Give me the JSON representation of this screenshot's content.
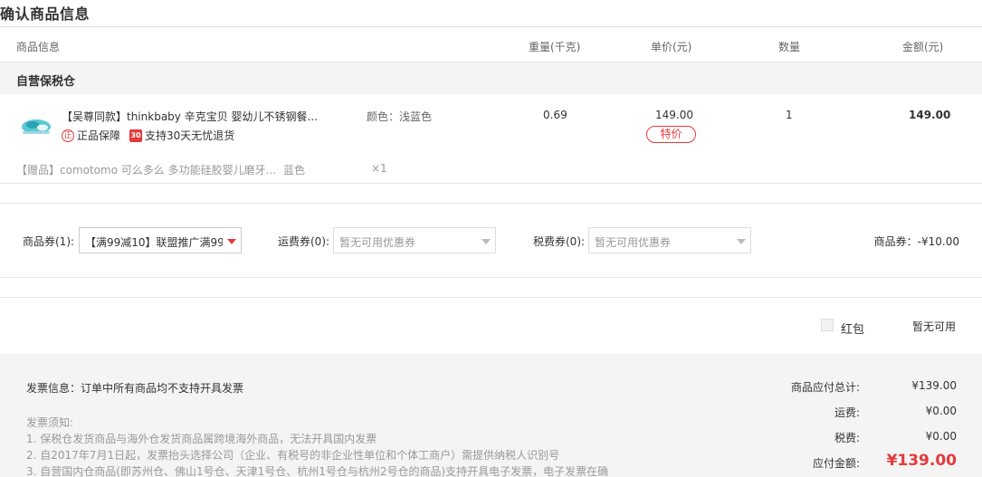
{
  "page_title": "确认商品信息",
  "columns": {
    "goods": "商品信息",
    "weight": "重量(千克)",
    "unit_price": "单价(元)",
    "quantity": "数量",
    "amount": "金额(元)"
  },
  "warehouse": "自营保税仓",
  "product": {
    "name": "【吴尊同款】thinkbaby 辛克宝贝 婴幼儿不锈钢餐...",
    "badge_authentic": "正品保障",
    "badge_30_icon": "30",
    "badge_return": "支持30天无忧退货",
    "color": "颜色：浅蓝色",
    "weight": "0.69",
    "price": "149.00",
    "price_tag": "特价",
    "qty": "1",
    "amount": "149.00"
  },
  "gift": {
    "name": "【赠品】comotomo 可么多么 多功能硅胶婴儿磨牙...",
    "color": "蓝色",
    "qty": "×1"
  },
  "coupons": {
    "goods_label": "商品券(1):",
    "goods_value": "【满99减10】联盟推广满99...",
    "shipping_label": "运费券(0):",
    "shipping_value": "暂无可用优惠券",
    "tax_label": "税费券(0):",
    "tax_value": "暂无可用优惠券",
    "summary": "商品券：-¥10.00"
  },
  "redpack": {
    "label": "红包",
    "status": "暂无可用"
  },
  "invoice": {
    "info": "发票信息：订单中所有商品均不支持开具发票",
    "notice_title": "发票须知:",
    "notices": [
      "1. 保税仓发货商品与海外仓发货商品属跨境海外商品，无法开具国内发票",
      "2. 自2017年7月1日起，发票抬头选择公司（企业、有税号的非企业性单位和个体工商户）需提供纳税人识别号",
      "3. 自营国内仓商品(即苏州仓、佛山1号仓、天津1号仓、杭州1号仓与杭州2号仓的商品)支持开具电子发票，电子发票在确"
    ]
  },
  "summary": {
    "subtotal_label": "商品应付总计:",
    "subtotal_value": "¥139.00",
    "shipping_label": "运费:",
    "shipping_value": "¥0.00",
    "tax_label": "税费:",
    "tax_value": "¥0.00",
    "total_label": "应付金额:",
    "total_value": "¥139.00"
  },
  "colors": {
    "accent": "#e4393c",
    "muted": "#999999",
    "panel": "#f4f4f4"
  }
}
